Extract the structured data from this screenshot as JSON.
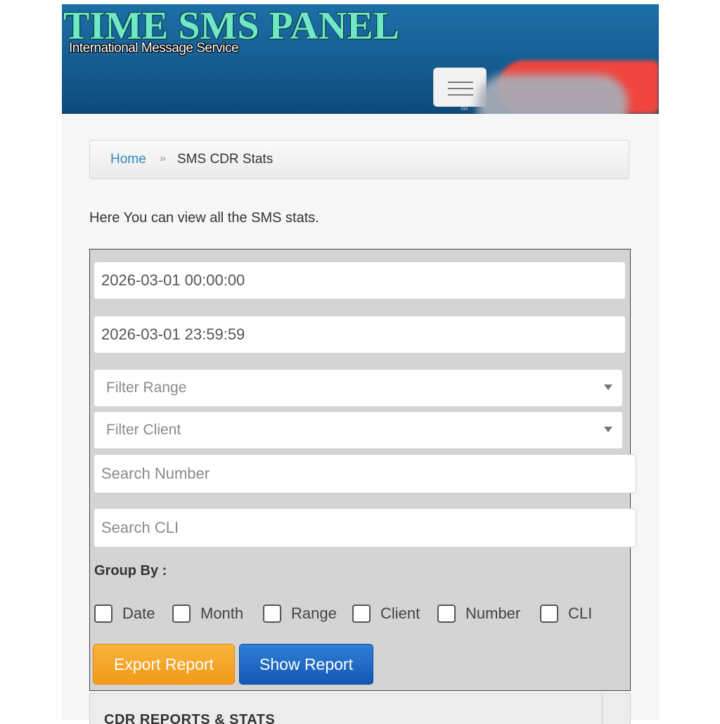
{
  "header": {
    "brand": "TIME SMS PANEL",
    "tagline": "International Message Service",
    "menu_sub": "IIIIIII"
  },
  "breadcrumb": {
    "home": "Home",
    "separator": "»",
    "current": "SMS CDR Stats"
  },
  "intro": "Here You can view all the SMS stats.",
  "form": {
    "start_datetime": "2026-03-01 00:00:00",
    "end_datetime": "2026-03-01 23:59:59",
    "filter_range_placeholder": "Filter Range",
    "filter_client_placeholder": "Filter Client",
    "search_number_placeholder": "Search Number",
    "search_cli_placeholder": "Search CLI",
    "group_by_label": "Group By :",
    "group_by_options": [
      "Date",
      "Month",
      "Range",
      "Client",
      "Number",
      "CLI"
    ],
    "export_label": "Export Report",
    "show_label": "Show Report"
  },
  "cdr_panel": {
    "title": "CDR REPORTS & STATS"
  },
  "colors": {
    "header_blue": "#155e93",
    "brand_green": "#6ee8c6",
    "link_blue": "#2e86c1",
    "export_orange": "#f29a1a",
    "show_blue": "#1457b3"
  }
}
